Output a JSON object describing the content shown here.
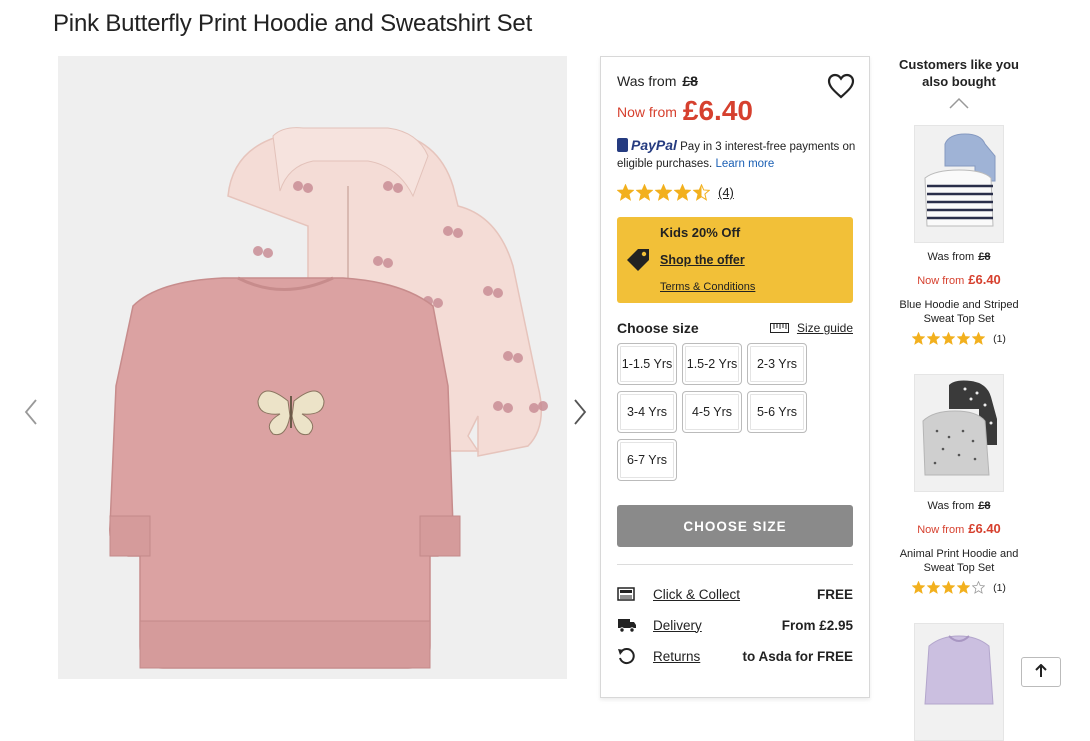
{
  "product": {
    "title": "Pink Butterfly Print Hoodie and Sweatshirt Set",
    "was_label": "Was from",
    "was_price": "£8",
    "now_label": "Now from",
    "now_price": "£6.40",
    "paypal": {
      "logo_text": "PayPal",
      "text": "Pay in 3 interest-free payments on eligible purchases.",
      "learn_more": "Learn more"
    },
    "rating": {
      "stars": 4.5,
      "count": "(4)"
    },
    "offer": {
      "title": "Kids 20% Off",
      "shop_link": "Shop the offer",
      "terms_link": "Terms & Conditions"
    },
    "choose_size_label": "Choose size",
    "size_guide_label": "Size guide",
    "sizes": [
      "1-1.5 Yrs",
      "1.5-2 Yrs",
      "2-3 Yrs",
      "3-4 Yrs",
      "4-5 Yrs",
      "5-6 Yrs",
      "6-7 Yrs"
    ],
    "choose_size_button": "CHOOSE SIZE",
    "services": [
      {
        "label": "Click & Collect",
        "value": "FREE",
        "icon": "store-icon"
      },
      {
        "label": "Delivery",
        "value": "From £2.95",
        "icon": "truck-icon"
      },
      {
        "label": "Returns",
        "value": "to Asda for FREE",
        "icon": "returns-icon"
      }
    ]
  },
  "recommendations": {
    "heading": "Customers like you also bought",
    "items": [
      {
        "name": "Blue Hoodie and Striped Sweat Top Set",
        "was_label": "Was from",
        "was_price": "£8",
        "now_label": "Now from",
        "now_price": "£6.40",
        "stars": 5,
        "count": "(1)"
      },
      {
        "name": "Animal Print Hoodie and Sweat Top Set",
        "was_label": "Was from",
        "was_price": "£8",
        "now_label": "Now from",
        "now_price": "£6.40",
        "stars": 4,
        "count": "(1)"
      }
    ]
  },
  "colors": {
    "price_red": "#d6402e",
    "offer_yellow": "#f2c038",
    "star_gold": "#f2b01e",
    "button_gray": "#8a8a8a",
    "sweatshirt_pink": "#dba2a2",
    "hoodie_pale_pink": "#f4dcd6"
  }
}
